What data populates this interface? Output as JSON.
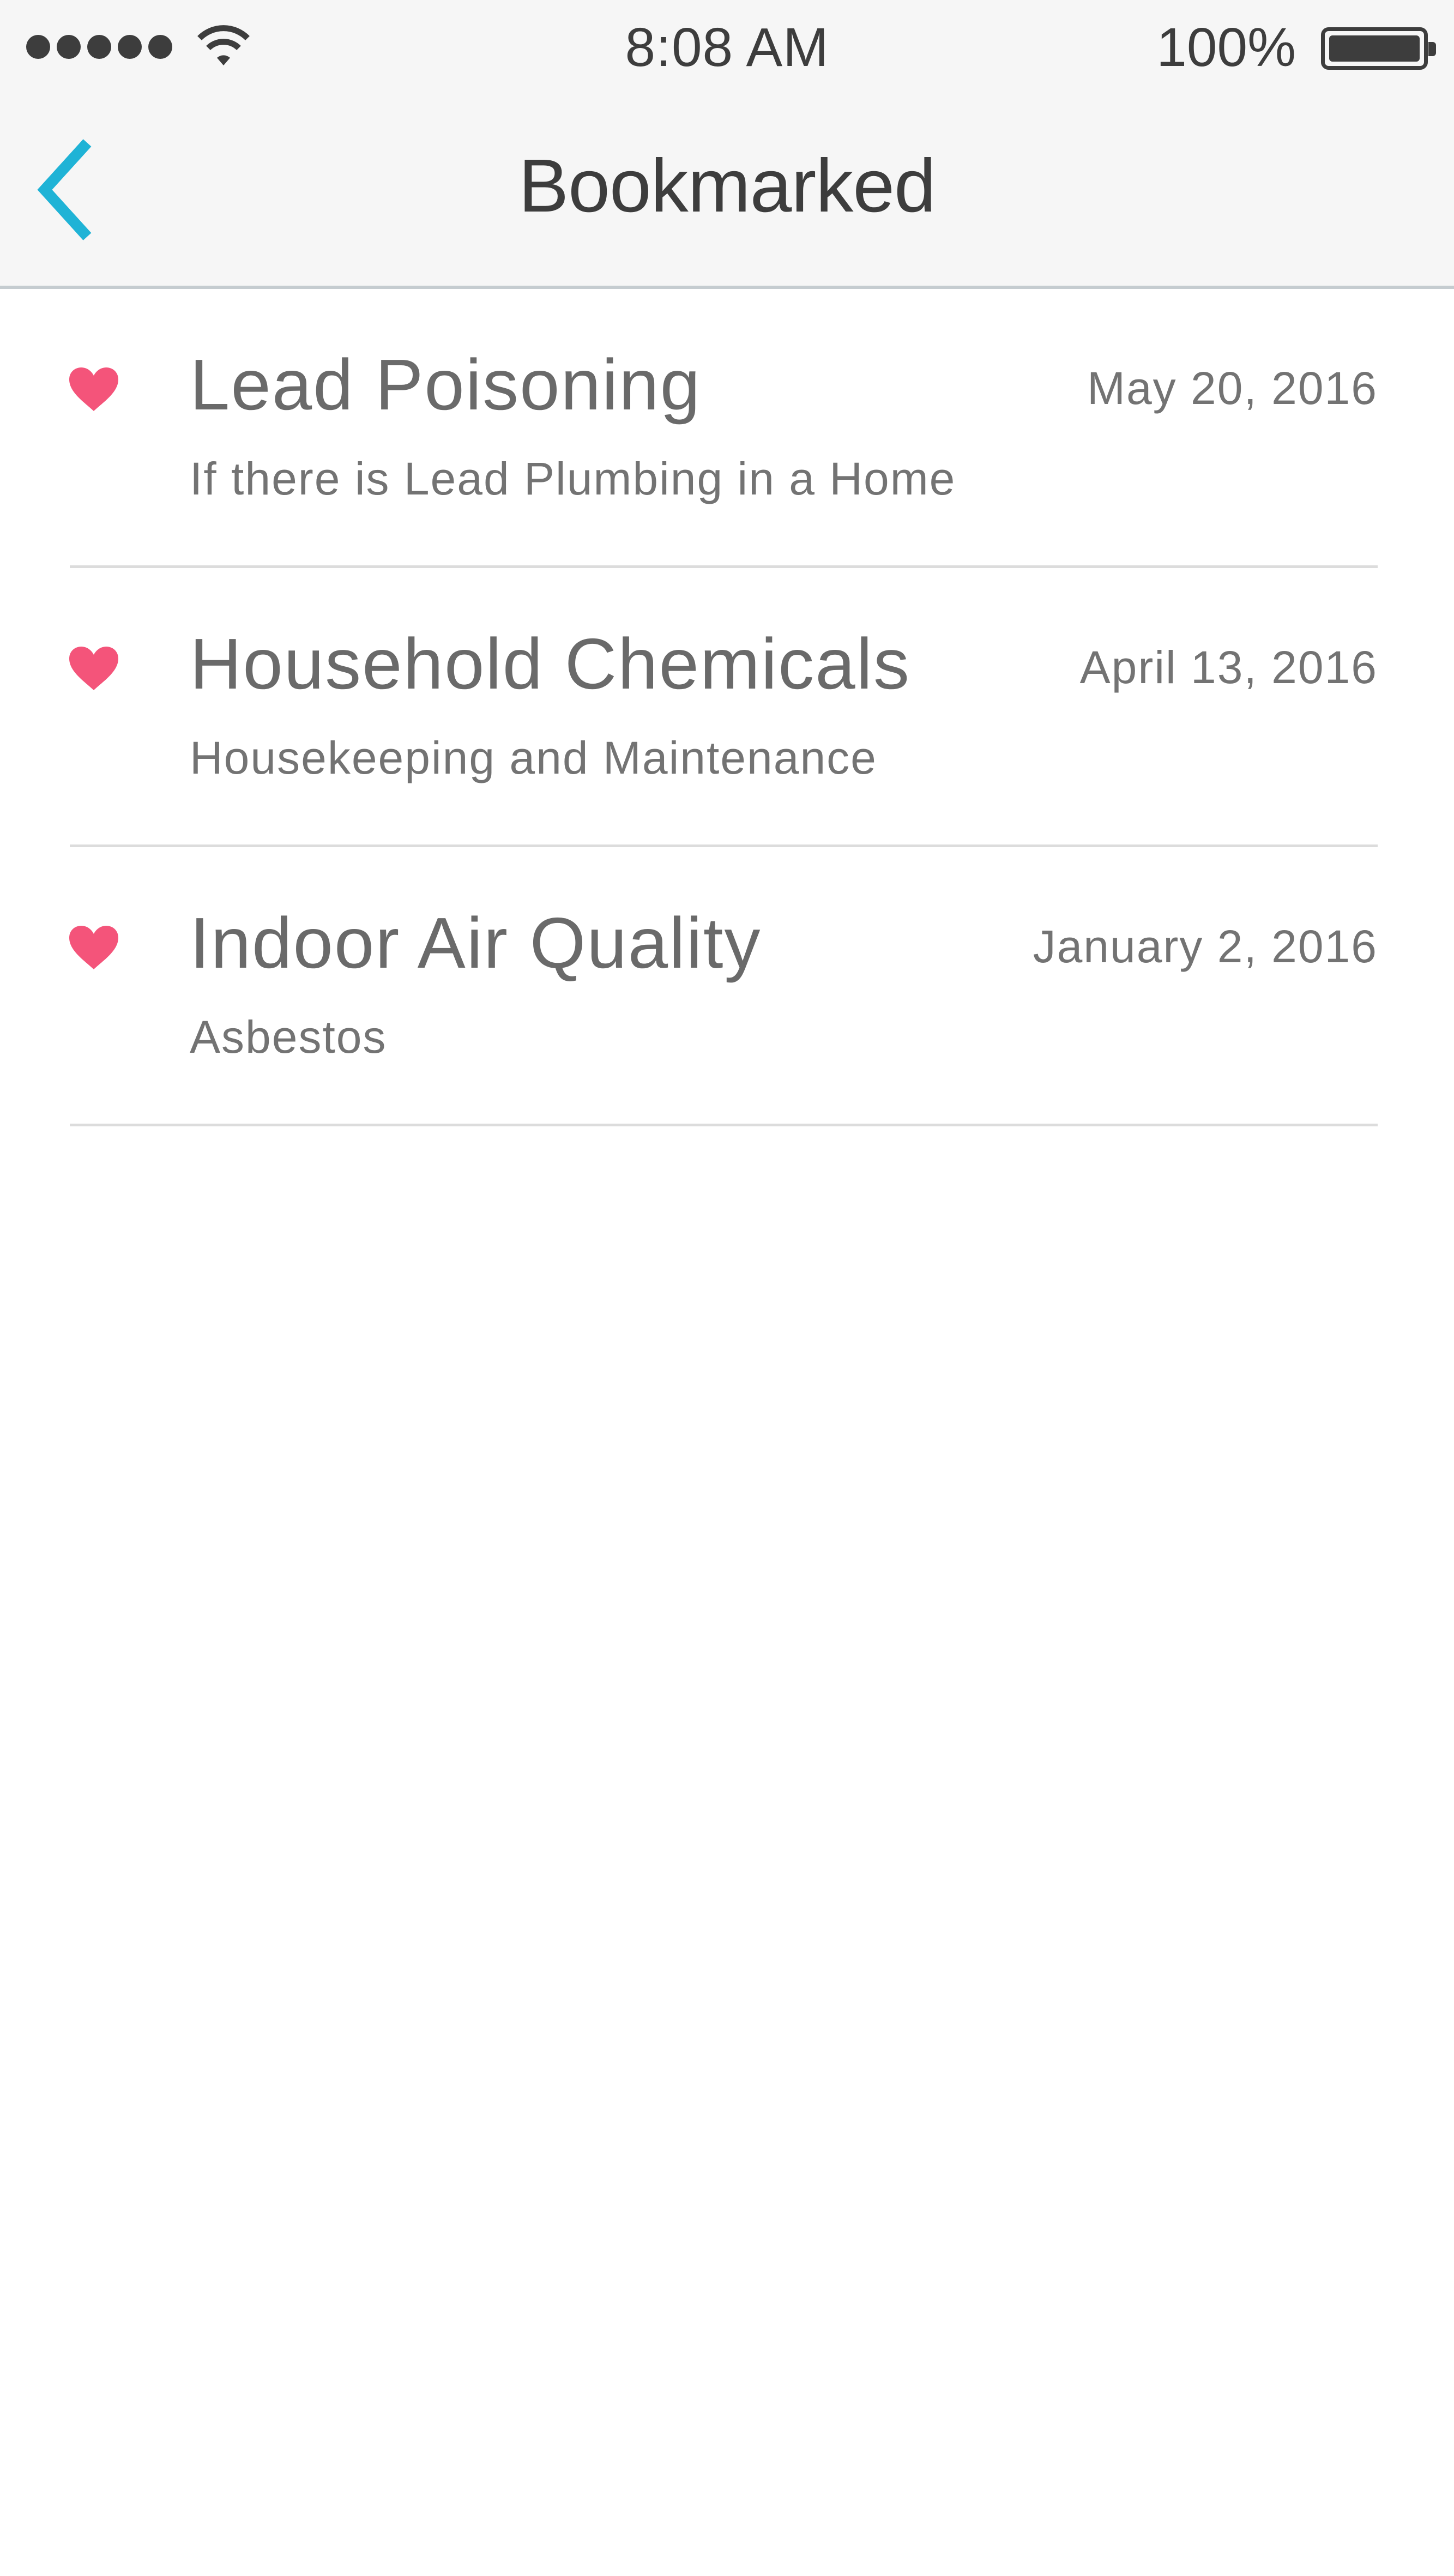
{
  "status_bar": {
    "time": "8:08 AM",
    "battery_percent": "100%",
    "signal_bars": 5,
    "battery_level": 1.0
  },
  "nav": {
    "title": "Bookmarked",
    "back_icon": "chevron-left-icon",
    "accent_color": "#1fb3d6"
  },
  "bookmarks": {
    "heart_icon": "heart-icon",
    "heart_color": "#f4547a",
    "items": [
      {
        "title": "Lead Poisoning",
        "subtitle": "If there is Lead Plumbing in a Home",
        "date": "May 20, 2016"
      },
      {
        "title": "Household Chemicals",
        "subtitle": "Housekeeping and Maintenance",
        "date": "April 13, 2016"
      },
      {
        "title": "Indoor Air Quality",
        "subtitle": "Asbestos",
        "date": "January 2, 2016"
      }
    ]
  }
}
